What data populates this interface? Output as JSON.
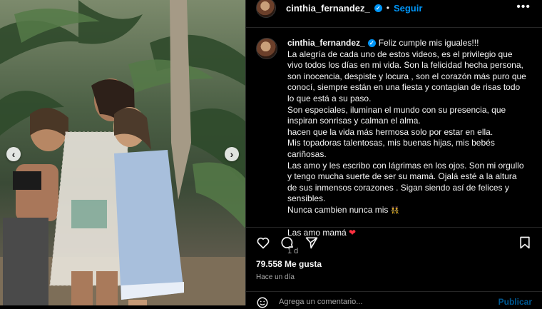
{
  "post": {
    "username": "cinthia_fernandez_",
    "follow_label": "Seguir",
    "separator": "•",
    "more_label": "•••",
    "verified_glyph": "✓"
  },
  "media": {
    "prev_glyph": "‹",
    "next_glyph": "›"
  },
  "caption": {
    "username": "cinthia_fernandez_",
    "first_line": "Feliz cumple mis iguales!!!",
    "paragraph1": "La alegría de cada uno de estos videos, es el privilegio que vivo todos los días en mi vida. Son la felicidad hecha persona, son inocencia, despiste y locura , son el corazón más puro que conocí, siempre están en una fiesta y contagian de risas todo lo que está a su paso.",
    "paragraph2": "Son especiales, iluminan el mundo con su presencia, que inspiran sonrisas y calman el alma.",
    "paragraph3": "hacen que la vida más hermosa solo por estar en ella.",
    "paragraph4": "Mis topadoras talentosas, mis buenas hijas, mis bebés cariñosas.",
    "paragraph5": "Las amo y les escribo con lágrimas en los ojos. Son mi orgullo y tengo mucha suerte de ser su mamá. Ojalá esté a la altura de sus inmensos corazones . Sigan siendo así de felices y sensibles.",
    "paragraph6": "Nunca cambien nunca mis",
    "emoji": "👯",
    "closing": "Las amo mamá",
    "heart": "❤",
    "time": "1 d"
  },
  "footer": {
    "likes": "79.558 Me gusta",
    "posted": "Hace un día",
    "comment_placeholder": "Agrega un comentario...",
    "publish_label": "Publicar"
  },
  "icons": {
    "like": "heart-outline-icon",
    "comment": "speech-bubble-icon",
    "share": "paper-plane-icon",
    "save": "bookmark-icon",
    "emoji": "smiley-icon"
  },
  "colors": {
    "accent": "#0095f6",
    "heart": "#ff3040",
    "background": "#000000",
    "muted_text": "#a8a8a8"
  }
}
